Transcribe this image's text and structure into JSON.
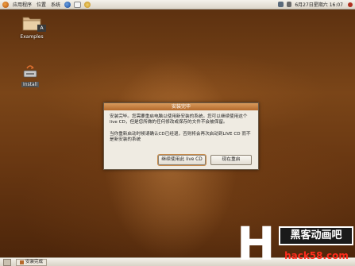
{
  "top_panel": {
    "menus": [
      "应用程序",
      "位置",
      "系统"
    ],
    "clock": "6月27日星期六 16:07"
  },
  "desktop": {
    "icons": [
      {
        "label": "Examples",
        "badge": "A"
      },
      {
        "label": "Install"
      }
    ]
  },
  "dialog": {
    "title": "安装完毕",
    "paragraph1": "安装完毕。您需要重启电脑以使用新安装的系统。您可以继续使用这个 live CD，但是您所做的任何修改或保存的文件不会被保留。",
    "paragraph2": "当你重新启动时候请确认CD已经退，否则将会再次启动到LIVE CD 而不是新安装的系统",
    "buttons": {
      "continue": "继续使用此 live CD",
      "restart": "现在重启"
    }
  },
  "taskbar": {
    "task_label": "安装完成"
  },
  "watermark": {
    "letter": "H",
    "title": "黑客动画吧",
    "site": "hack58.com"
  },
  "colors": {
    "accent": "#c98b4a",
    "dialog_title": "#b56a2c",
    "watermark_site": "#ff2c1c"
  }
}
